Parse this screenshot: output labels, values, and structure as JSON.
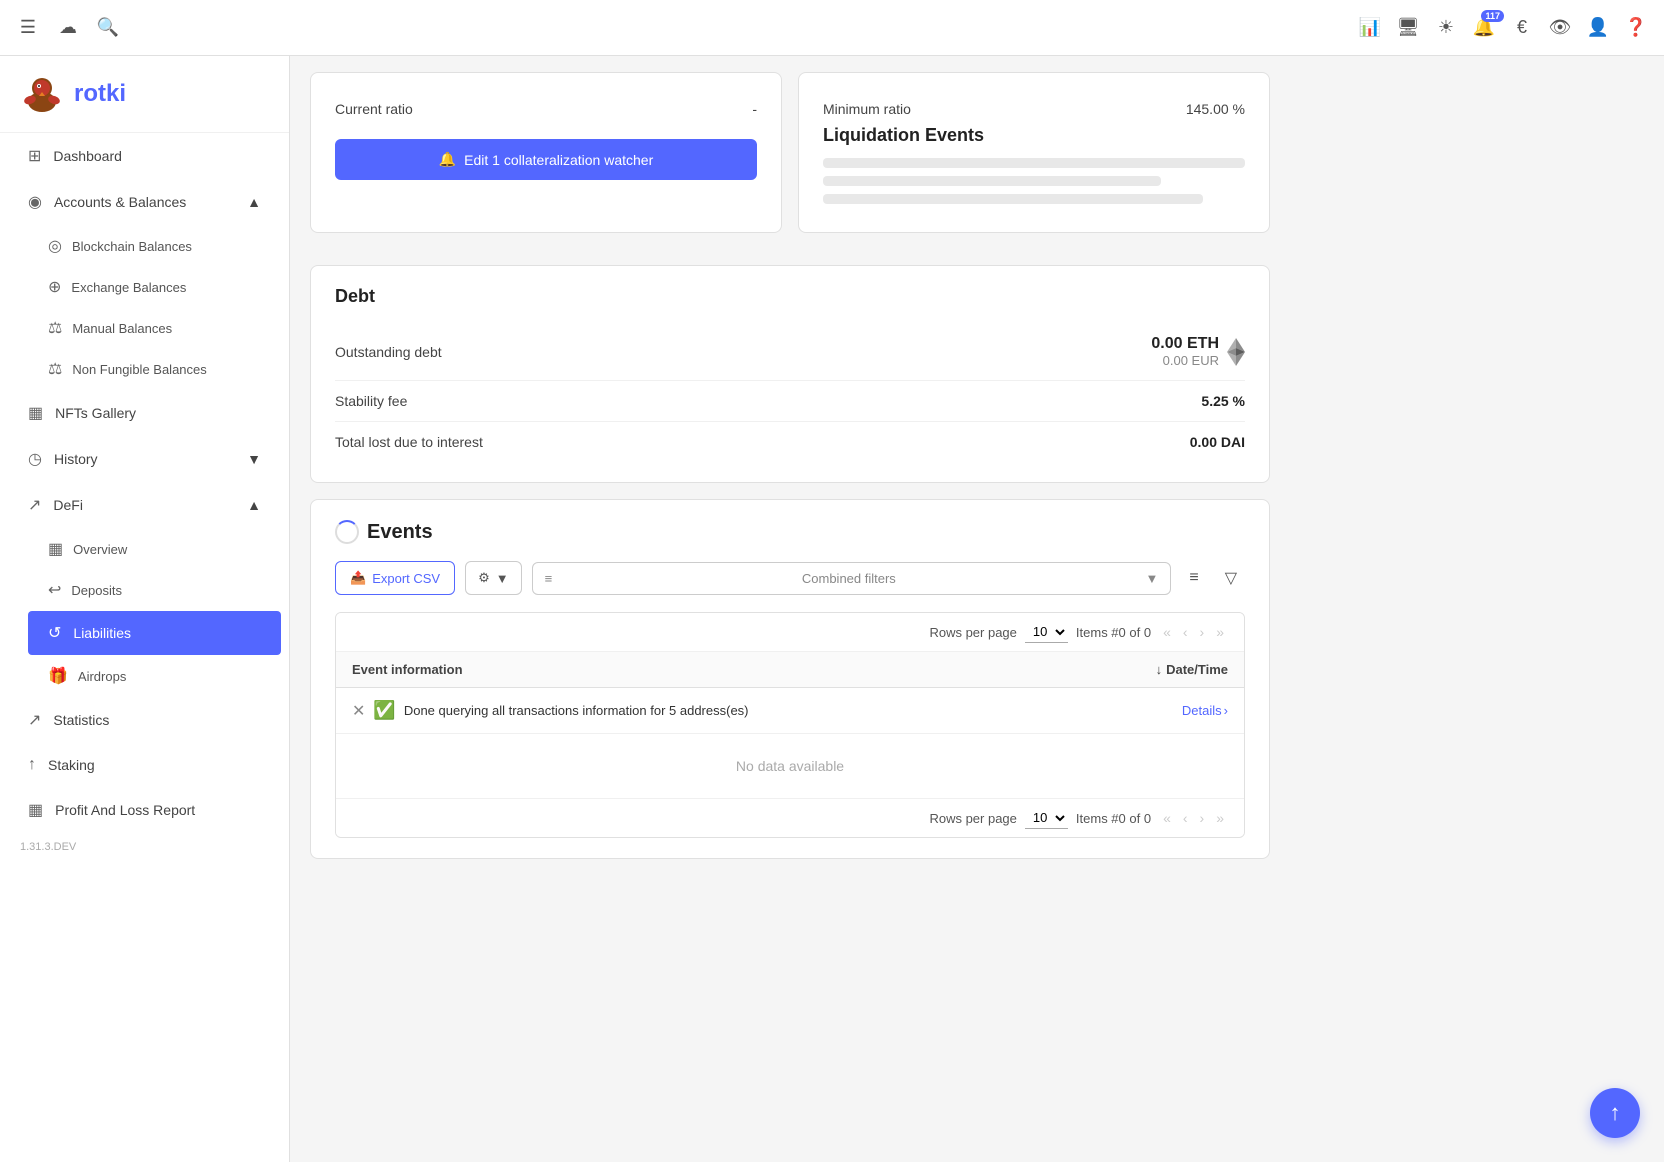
{
  "topbar": {
    "icons": [
      "menu",
      "cloud",
      "search"
    ],
    "right_icons": [
      "chart",
      "display",
      "sun",
      "euro",
      "eye",
      "person",
      "help"
    ],
    "notification_count": "117"
  },
  "sidebar": {
    "logo_text": "rotki",
    "version": "1.31.3.DEV",
    "items": [
      {
        "id": "dashboard",
        "label": "Dashboard",
        "icon": "⊞"
      },
      {
        "id": "accounts-balances",
        "label": "Accounts & Balances",
        "icon": "◉",
        "expanded": true,
        "children": [
          {
            "id": "blockchain-balances",
            "label": "Blockchain Balances",
            "icon": "◎"
          },
          {
            "id": "exchange-balances",
            "label": "Exchange Balances",
            "icon": "⊕"
          },
          {
            "id": "manual-balances",
            "label": "Manual Balances",
            "icon": "⚖"
          },
          {
            "id": "non-fungible-balances",
            "label": "Non Fungible Balances",
            "icon": "⚖"
          }
        ]
      },
      {
        "id": "nfts-gallery",
        "label": "NFTs Gallery",
        "icon": "▦"
      },
      {
        "id": "history",
        "label": "History",
        "icon": "◷",
        "expanded": false
      },
      {
        "id": "defi",
        "label": "DeFi",
        "icon": "↗",
        "expanded": true,
        "children": [
          {
            "id": "overview",
            "label": "Overview",
            "icon": "▦"
          },
          {
            "id": "deposits",
            "label": "Deposits",
            "icon": "↩"
          },
          {
            "id": "liabilities",
            "label": "Liabilities",
            "icon": "↺",
            "active": true
          },
          {
            "id": "airdrops",
            "label": "Airdrops",
            "icon": "🎁"
          }
        ]
      },
      {
        "id": "statistics",
        "label": "Statistics",
        "icon": "↗"
      },
      {
        "id": "staking",
        "label": "Staking",
        "icon": "↑"
      },
      {
        "id": "profit-loss",
        "label": "Profit And Loss Report",
        "icon": "▦"
      }
    ]
  },
  "content": {
    "top_section": {
      "current_ratio_label": "Current ratio",
      "current_ratio_value": "-",
      "minimum_ratio_label": "Minimum ratio",
      "minimum_ratio_value": "145.00 %",
      "edit_button_label": "Edit 1 collateralization watcher",
      "liquidation_title": "Liquidation Events"
    },
    "debt": {
      "title": "Debt",
      "outstanding_debt_label": "Outstanding debt",
      "outstanding_debt_eth": "0.00 ETH",
      "outstanding_debt_eur": "0.00 EUR",
      "stability_fee_label": "Stability fee",
      "stability_fee_value": "5.25 %",
      "total_lost_label": "Total lost due to interest",
      "total_lost_value": "0.00 DAI"
    },
    "events": {
      "title": "Events",
      "export_csv_label": "Export CSV",
      "combined_filters_placeholder": "Combined filters",
      "table_header": {
        "event_info": "Event information",
        "datetime": "Date/Time"
      },
      "pagination_top": {
        "rows_per_page_label": "Rows per page",
        "rows_value": "10",
        "items_label": "Items #0 of 0"
      },
      "notification": {
        "text": "Done querying all transactions information for 5 address(es)",
        "details_label": "Details"
      },
      "no_data": "No data available",
      "pagination_bottom": {
        "rows_per_page_label": "Rows per page",
        "rows_value": "10",
        "items_label": "Items #0 of 0"
      }
    }
  }
}
